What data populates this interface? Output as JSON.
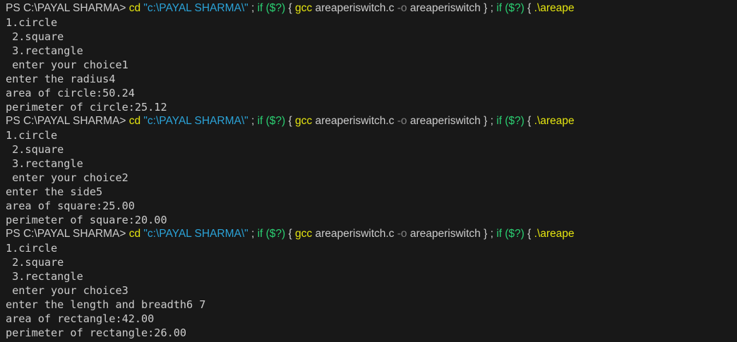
{
  "terminal": {
    "prompt_path": "PS C:\\PAYAL SHARMA> ",
    "command_tokens": [
      {
        "text": "cd",
        "kind": "cmd"
      },
      {
        "text": " ",
        "kind": "plain"
      },
      {
        "text": "\"c:\\PAYAL SHARMA\\\"",
        "kind": "str"
      },
      {
        "text": " ; ",
        "kind": "plain"
      },
      {
        "text": "if",
        "kind": "kw"
      },
      {
        "text": " ",
        "kind": "plain"
      },
      {
        "text": "($?)",
        "kind": "kw"
      },
      {
        "text": " { ",
        "kind": "plain"
      },
      {
        "text": "gcc",
        "kind": "cmd"
      },
      {
        "text": " areaperiswitch.c ",
        "kind": "plain"
      },
      {
        "text": "-o",
        "kind": "flag"
      },
      {
        "text": " areaperiswitch } ; ",
        "kind": "plain"
      },
      {
        "text": "if",
        "kind": "kw"
      },
      {
        "text": " ",
        "kind": "plain"
      },
      {
        "text": "($?)",
        "kind": "kw"
      },
      {
        "text": " { ",
        "kind": "plain"
      },
      {
        "text": ".\\areape",
        "kind": "cmd"
      }
    ],
    "runs": [
      {
        "output": [
          "1.circle",
          " 2.square",
          " 3.rectangle",
          " enter your choice1",
          "enter the radius4",
          "area of circle:50.24",
          "perimeter of circle:25.12"
        ]
      },
      {
        "output": [
          "1.circle",
          " 2.square",
          " 3.rectangle",
          " enter your choice2",
          "enter the side5",
          "area of square:25.00",
          "perimeter of square:20.00"
        ]
      },
      {
        "output": [
          "1.circle",
          " 2.square",
          " 3.rectangle",
          " enter your choice3",
          "enter the length and breadth6 7",
          "area of rectangle:42.00",
          "perimeter of rectangle:26.00"
        ]
      }
    ]
  },
  "colors": {
    "background": "#181818",
    "text": "#cccccc",
    "command": "#e5e510",
    "string": "#2ba3d8",
    "keyword": "#2bcf72",
    "flag": "#808080"
  }
}
